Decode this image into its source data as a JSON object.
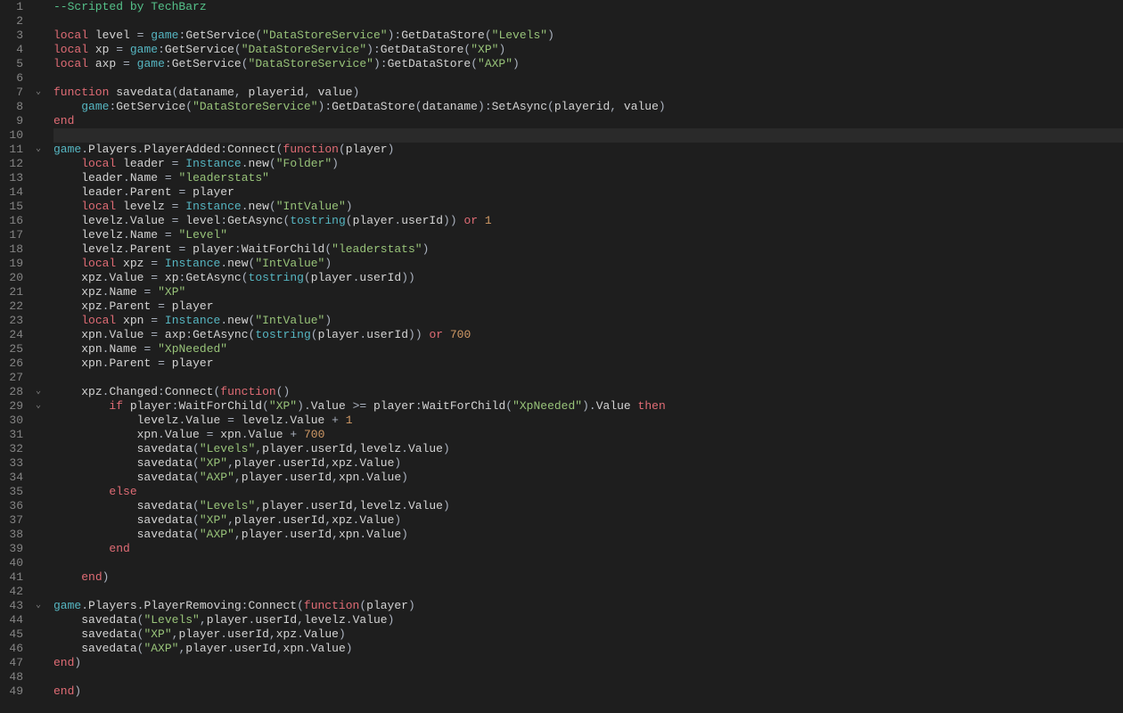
{
  "editor": {
    "current_line": 10,
    "line_numbers": [
      "1",
      "2",
      "3",
      "4",
      "5",
      "6",
      "7",
      "8",
      "9",
      "10",
      "11",
      "12",
      "13",
      "14",
      "15",
      "16",
      "17",
      "18",
      "19",
      "20",
      "21",
      "22",
      "23",
      "24",
      "25",
      "26",
      "27",
      "28",
      "29",
      "30",
      "31",
      "32",
      "33",
      "34",
      "35",
      "36",
      "37",
      "38",
      "39",
      "40",
      "41",
      "42",
      "43",
      "44",
      "45",
      "46",
      "47",
      "48",
      "49"
    ],
    "fold_markers": {
      "7": "v",
      "11": "v",
      "28": "v",
      "29": "v",
      "43": "v"
    }
  },
  "code": {
    "raw_lines": [
      "--Scripted by TechBarz",
      "",
      "local level = game:GetService(\"DataStoreService\"):GetDataStore(\"Levels\")",
      "local xp = game:GetService(\"DataStoreService\"):GetDataStore(\"XP\")",
      "local axp = game:GetService(\"DataStoreService\"):GetDataStore(\"AXP\")",
      "",
      "function savedata(dataname, playerid, value)",
      "    game:GetService(\"DataStoreService\"):GetDataStore(dataname):SetAsync(playerid, value)",
      "end",
      "",
      "game.Players.PlayerAdded:Connect(function(player)",
      "    local leader = Instance.new(\"Folder\")",
      "    leader.Name = \"leaderstats\"",
      "    leader.Parent = player",
      "    local levelz = Instance.new(\"IntValue\")",
      "    levelz.Value = level:GetAsync(tostring(player.userId)) or 1",
      "    levelz.Name = \"Level\"",
      "    levelz.Parent = player:WaitForChild(\"leaderstats\")",
      "    local xpz = Instance.new(\"IntValue\")",
      "    xpz.Value = xp:GetAsync(tostring(player.userId))",
      "    xpz.Name = \"XP\"",
      "    xpz.Parent = player",
      "    local xpn = Instance.new(\"IntValue\")",
      "    xpn.Value = axp:GetAsync(tostring(player.userId)) or 700",
      "    xpn.Name = \"XpNeeded\"",
      "    xpn.Parent = player",
      "",
      "    xpz.Changed:Connect(function()",
      "        if player:WaitForChild(\"XP\").Value >= player:WaitForChild(\"XpNeeded\").Value then",
      "            levelz.Value = levelz.Value + 1",
      "            xpn.Value = xpn.Value + 700",
      "            savedata(\"Levels\",player.userId,levelz.Value)",
      "            savedata(\"XP\",player.userId,xpz.Value)",
      "            savedata(\"AXP\",player.userId,xpn.Value)",
      "        else",
      "            savedata(\"Levels\",player.userId,levelz.Value)",
      "            savedata(\"XP\",player.userId,xpz.Value)",
      "            savedata(\"AXP\",player.userId,xpn.Value)",
      "        end",
      "",
      "    end)",
      "",
      "game.Players.PlayerRemoving:Connect(function(player)",
      "    savedata(\"Levels\",player.userId,levelz.Value)",
      "    savedata(\"XP\",player.userId,xpz.Value)",
      "    savedata(\"AXP\",player.userId,xpn.Value)",
      "end)",
      "",
      "end)"
    ]
  },
  "syntax": {
    "keywords": [
      "local",
      "function",
      "end",
      "if",
      "then",
      "else",
      "or"
    ],
    "builtins": [
      "game",
      "tostring",
      "Instance"
    ]
  }
}
